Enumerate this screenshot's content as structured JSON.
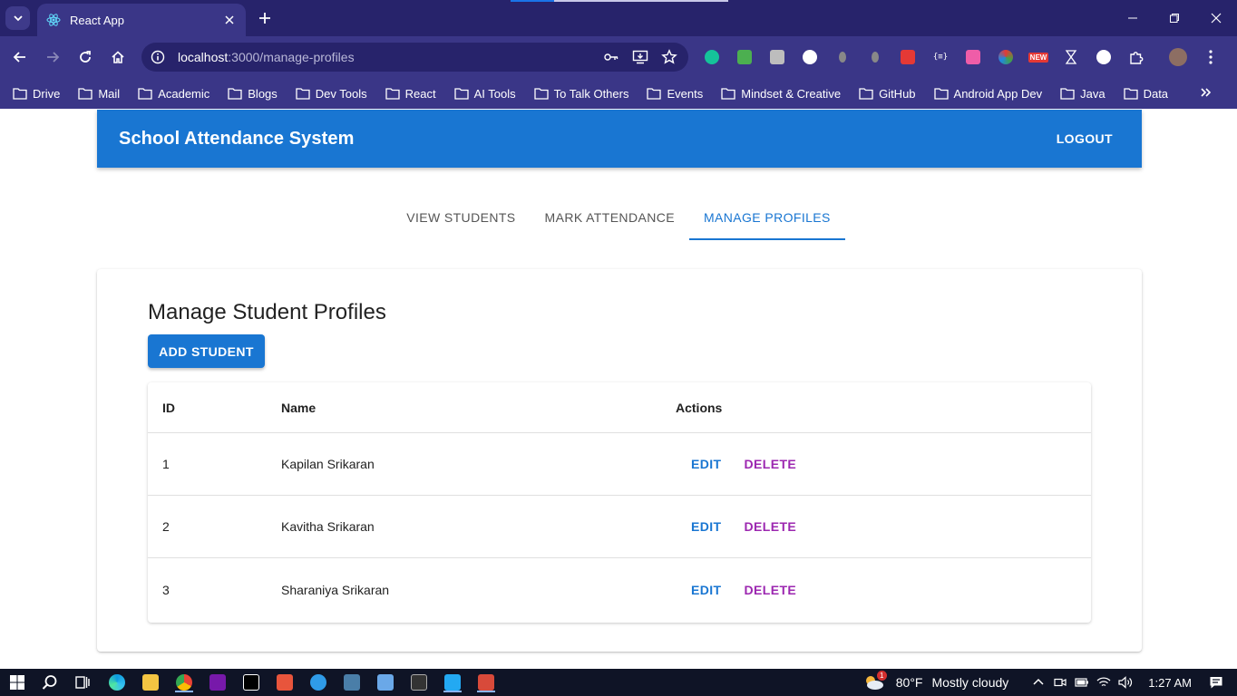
{
  "browser": {
    "tab_title": "React App",
    "url_host": "localhost",
    "url_path": ":3000/manage-profiles",
    "bookmarks": [
      "Drive",
      "Mail",
      "Academic",
      "Blogs",
      "Dev Tools",
      "React",
      "AI Tools",
      "To Talk Others",
      "Events",
      "Mindset & Creative",
      "GitHub",
      "Android App Dev",
      "Java",
      "Data"
    ],
    "new_badge": "NEW",
    "page_load_progress": 0.2
  },
  "app": {
    "title": "School Attendance System",
    "logout_label": "LOGOUT",
    "tabs": [
      {
        "label": "VIEW STUDENTS"
      },
      {
        "label": "MARK ATTENDANCE"
      },
      {
        "label": "MANAGE PROFILES"
      }
    ],
    "active_tab": 2
  },
  "profiles": {
    "heading": "Manage Student Profiles",
    "add_label": "ADD STUDENT",
    "columns": {
      "id": "ID",
      "name": "Name",
      "actions": "Actions"
    },
    "edit_label": "EDIT",
    "delete_label": "DELETE",
    "rows": [
      {
        "id": "1",
        "name": "Kapilan Srikaran"
      },
      {
        "id": "2",
        "name": "Kavitha Srikaran"
      },
      {
        "id": "3",
        "name": "Sharaniya Srikaran"
      }
    ]
  },
  "taskbar": {
    "temperature": "80°F",
    "weather": "Mostly cloudy",
    "weather_badge": "1",
    "time": "1:27 AM"
  },
  "colors": {
    "primary": "#1976d2",
    "secondary": "#9c27b0",
    "chrome_dark": "#27236b",
    "chrome": "#3a3687"
  }
}
